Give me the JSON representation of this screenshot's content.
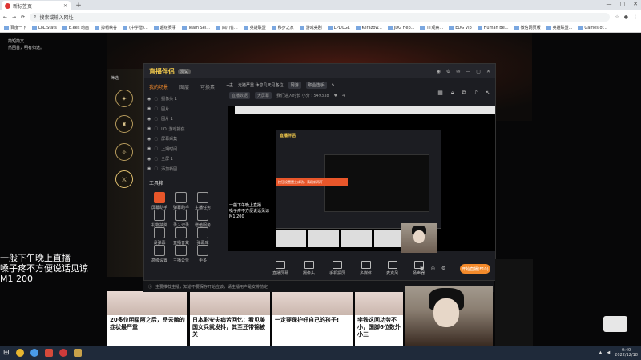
{
  "browser": {
    "tab_title": "新标签页",
    "address_placeholder": "搜索或输入网址",
    "bookmarks": [
      "百度一下",
      "LoL Stats",
      "b.ees 动画",
      "掉帽峡谷",
      "(中学僧)...",
      "超级赛事",
      "Team Sel...",
      "四川省...",
      "英雄联盟",
      "移步之家",
      "游戏美剧",
      "LPL/LGL",
      "Kerazow...",
      "JDG Hep...",
      "TT观察...",
      "EDG Vlp",
      "Human Be...",
      "微信网页版",
      "英雄联盟...",
      "Games of..."
    ]
  },
  "page": {
    "top_left_line1": "简短简文",
    "top_left_line2": "然回首，明有归途。",
    "section_label": "筛选",
    "overlay_text_line1": "一般下午晚上直播",
    "overlay_text_line2": "嗓子疼不方便说话见谅",
    "overlay_text_line3": "M1 200",
    "cards": [
      "20多位明星阿之后，岳云鹏的症状最严重",
      "日本彩安夫病苦回忆：看见美国女兵就发抖，其至还带锦被关",
      "一定要保护好自己的孩子!",
      "李铁这回功劳不小，国脚6位数外小三"
    ]
  },
  "app": {
    "logo": "直播伴侣",
    "badge": "测试",
    "source_tabs": [
      "我的场景",
      "图层",
      "可换素"
    ],
    "sources": [
      "摄像头 1",
      "图片",
      "图片 1",
      "LOL游戏捕获",
      "屏幕采集",
      "上期时间",
      "全屏 1",
      "添加新图"
    ],
    "tools_label": "工具箱",
    "tools": [
      "屏幕助手",
      "弹幕助手",
      "主播任务",
      "礼物抽奖",
      "录入记录",
      "增值服务",
      "设弹幕",
      "直播音效",
      "弹幕库",
      "高级设置",
      "主播公告",
      "更多"
    ],
    "title_label": "主",
    "title_value": "光猪严重 休息几天见各位",
    "category": "网游",
    "room_label": "职业选手",
    "status_label": "直播数据",
    "mode_label": "大屏幕",
    "room_info": "我们进入时长 小分 : 549338",
    "likes": "4",
    "toast_text": "按钮设置置立成功，请刷新再开",
    "bottom_tools": [
      "直播屏幕",
      "摄像头",
      "手机投屏",
      "多媒体",
      "麦克风",
      "扬声器"
    ],
    "start_button": "开始直播(F10)",
    "notice": "主要推荐主播，知道不要保存开始应该，请主播用户是安排前定"
  },
  "taskbar": {
    "time": "0:40",
    "date": "2022/12/18"
  }
}
